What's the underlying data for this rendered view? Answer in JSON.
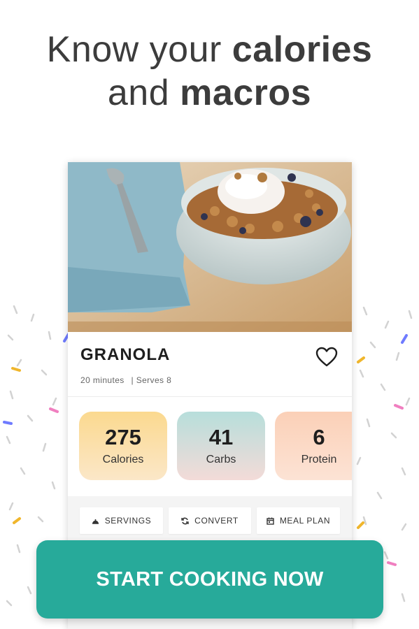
{
  "headline": {
    "line1_light": "Know your ",
    "line1_bold": "calories",
    "line2_light": "and ",
    "line2_bold": "macros"
  },
  "recipe": {
    "title": "GRANOLA",
    "time": "20 minutes",
    "serves": "| Serves 8",
    "image_icon": "granola-bowl-photo",
    "favorite_icon": "heart-outline-icon"
  },
  "macros": [
    {
      "value": "275",
      "label": "Calories"
    },
    {
      "value": "41",
      "label": "Carbs"
    },
    {
      "value": "6",
      "label": "Protein"
    }
  ],
  "actions": [
    {
      "label": "SERVINGS",
      "icon": "servings-icon"
    },
    {
      "label": "CONVERT",
      "icon": "convert-icon"
    },
    {
      "label": "MEAL PLAN",
      "icon": "calendar-icon"
    }
  ],
  "cta": {
    "label": "START COOKING NOW"
  },
  "colors": {
    "accent": "#27aa9a",
    "calories": "#fbd98f",
    "carbs": "#b7dedb",
    "protein": "#fbd0b7"
  }
}
